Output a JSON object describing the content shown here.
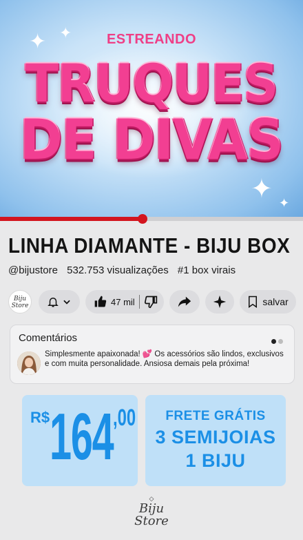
{
  "hero": {
    "kicker": "ESTREANDO",
    "title_line1": "TRUQUES",
    "title_line2": "DE DIVAS"
  },
  "player": {
    "progress": 0.47,
    "progress_color": "#d3151f"
  },
  "video": {
    "title": "LINHA DIAMANTE - BIJU BOX",
    "channel": "@bijustore",
    "views": "532.753 visualizações",
    "rank": "#1 box virais"
  },
  "actions": {
    "channel_logo_line1": "Biju",
    "channel_logo_line2": "Store",
    "likes": "47 mil",
    "save_label": "salvar",
    "icons": [
      "bell-icon",
      "chevron-down-icon",
      "thumbs-up-icon",
      "thumbs-down-icon",
      "share-icon",
      "sparkle-icon",
      "bookmark-icon"
    ]
  },
  "comments": {
    "heading": "Comentários",
    "text": "Simplesmente apaixonada! 💕 Os acessórios são lindos, exclusivos e com muita personalidade. Ansiosa demais pela próxima!"
  },
  "offer": {
    "currency": "R$",
    "amount": "164",
    "cents": ",00",
    "shipping": "FRETE GRÁTIS",
    "items_line1": "3 SEMIJOIAS",
    "items_line2": "1 BIJU",
    "accent_color": "#1b8fe6"
  },
  "footer": {
    "brand_line1": "Biju",
    "brand_line2": "Store"
  }
}
